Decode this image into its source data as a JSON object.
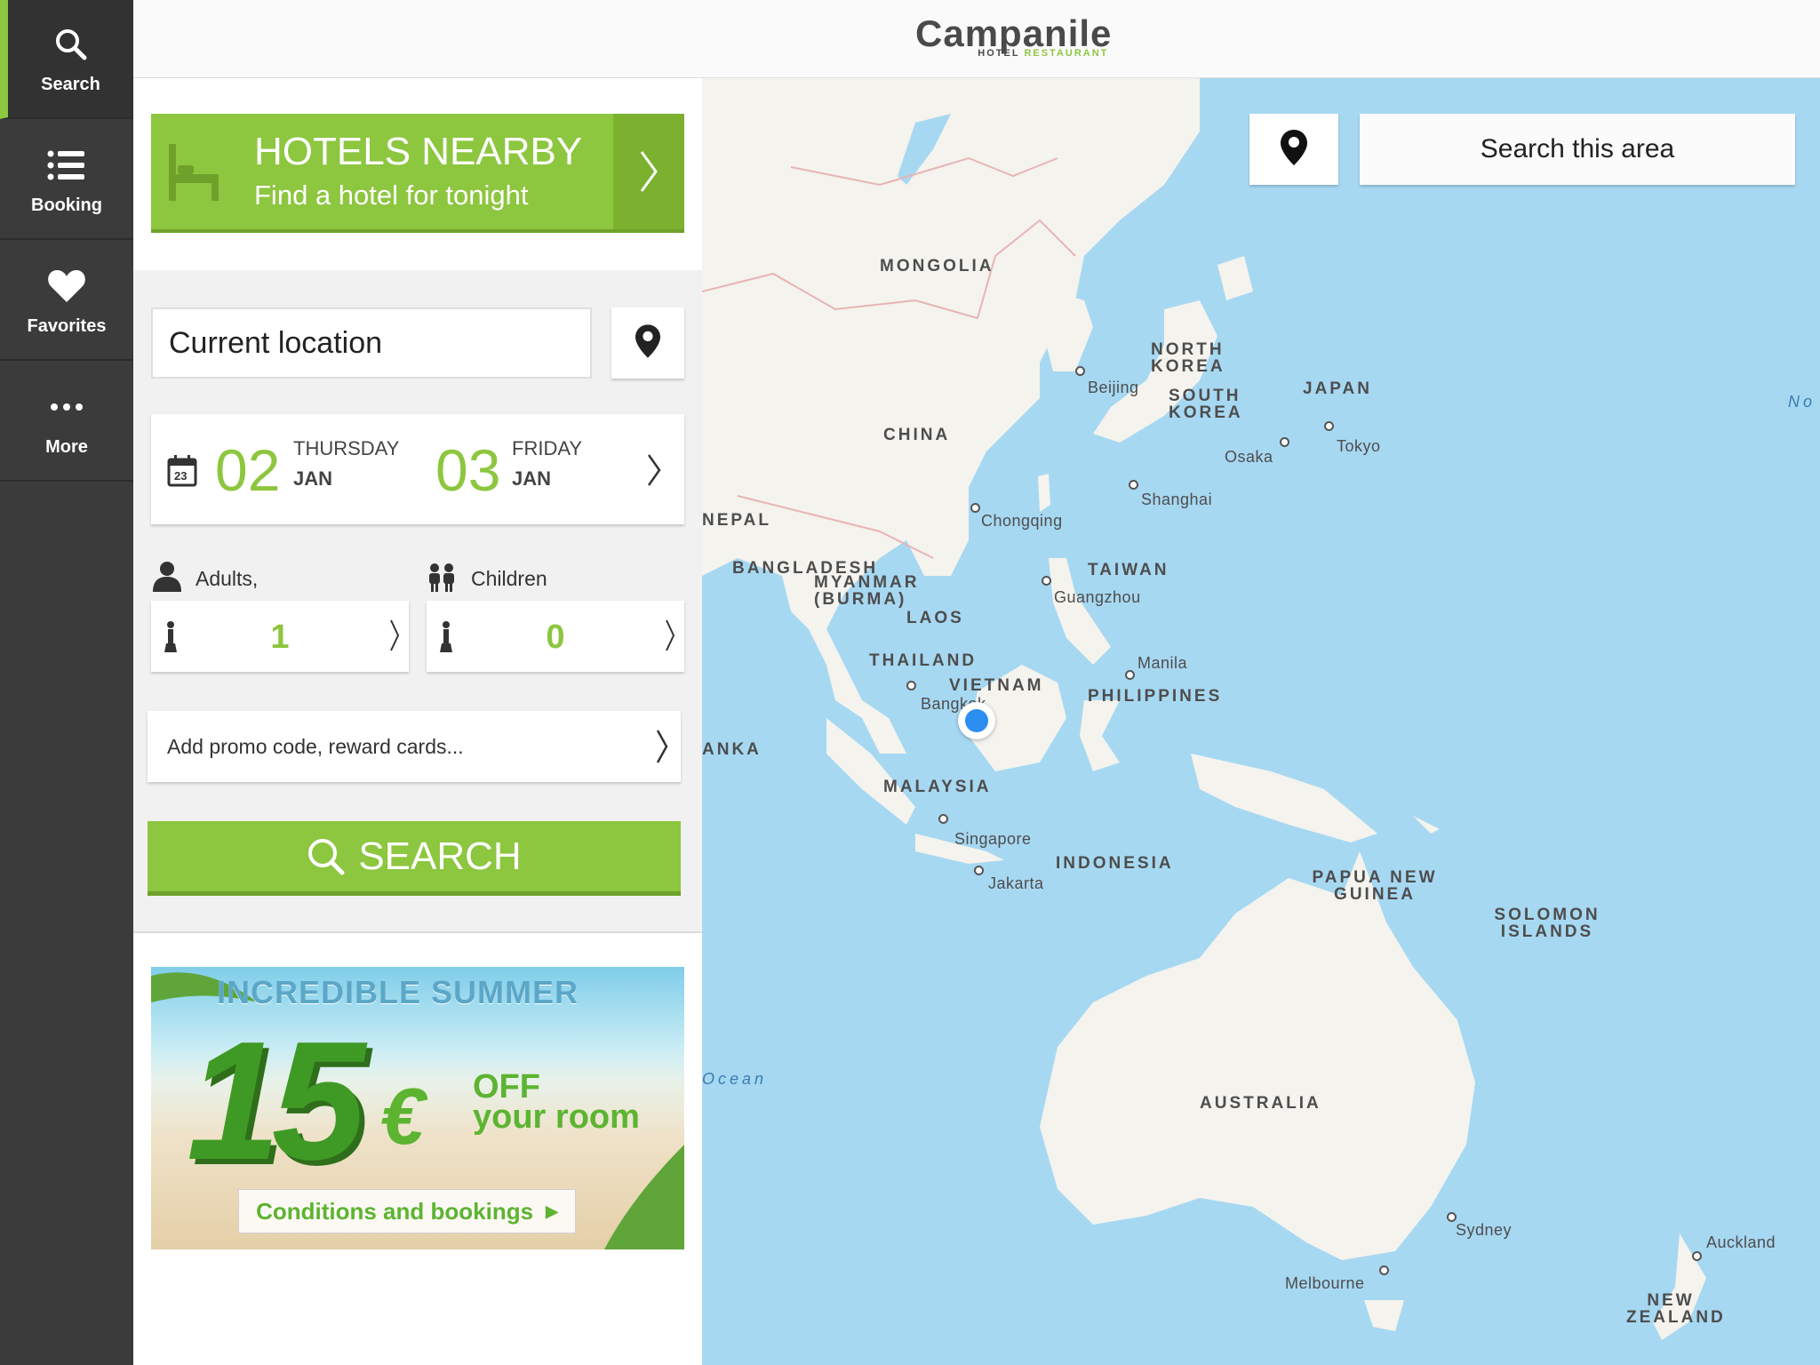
{
  "nav": {
    "items": [
      {
        "label": "Search",
        "icon": "search-icon"
      },
      {
        "label": "Booking",
        "icon": "list-icon"
      },
      {
        "label": "Favorites",
        "icon": "heart-icon"
      },
      {
        "label": "More",
        "icon": "more-dots-icon"
      }
    ]
  },
  "header": {
    "logo": {
      "main": "Campanile",
      "sub_hotel": "HOTEL",
      "sub_restaurant": "RESTAURANT"
    }
  },
  "hotels_nearby": {
    "title": "HOTELS NEARBY",
    "subtitle": "Find a hotel for tonight"
  },
  "location": {
    "value": "Current location"
  },
  "dates": {
    "checkin": {
      "day_num": "02",
      "weekday": "THURSDAY",
      "month": "JAN"
    },
    "checkout": {
      "day_num": "03",
      "weekday": "FRIDAY",
      "month": "JAN"
    },
    "calendar_icon_day": "23"
  },
  "guests": {
    "adults_label": "Adults,",
    "children_label": "Children",
    "adults_count": "1",
    "children_count": "0"
  },
  "promo": {
    "placeholder": "Add promo code, reward cards..."
  },
  "search_button": {
    "label": "SEARCH"
  },
  "banner": {
    "title": "INCREDIBLE SUMMER",
    "amount": "15",
    "currency": "€",
    "offer_line1": "OFF",
    "offer_line2": "your room",
    "link": "Conditions and bookings"
  },
  "map": {
    "search_area_label": "Search this area",
    "countries": [
      "MONGOLIA",
      "CHINA",
      "NORTH KOREA",
      "SOUTH KOREA",
      "JAPAN",
      "NEPAL",
      "BANGLADESH",
      "MYANMAR (BURMA)",
      "LAOS",
      "THAILAND",
      "VIETNAM",
      "TAIWAN",
      "PHILIPPINES",
      "MALAYSIA",
      "INDONESIA",
      "PAPUA NEW GUINEA",
      "SOLOMON ISLANDS",
      "AUSTRALIA",
      "NEW ZEALAND",
      "ANKA"
    ],
    "cities": [
      "Beijing",
      "Shanghai",
      "Chongqing",
      "Osaka",
      "Tokyo",
      "Guangzhou",
      "Manila",
      "Bangkok",
      "Singapore",
      "Jakarta",
      "Sydney",
      "Melbourne",
      "Auckland"
    ],
    "ocean_fragment": "Ocean",
    "edge_fragment": "No"
  },
  "colors": {
    "brand_green": "#8dc63f",
    "nav_bg": "#3b3b3b",
    "sea": "#a7d8f2",
    "land": "#f4f3ee",
    "location_dot": "#2b8ef0"
  }
}
